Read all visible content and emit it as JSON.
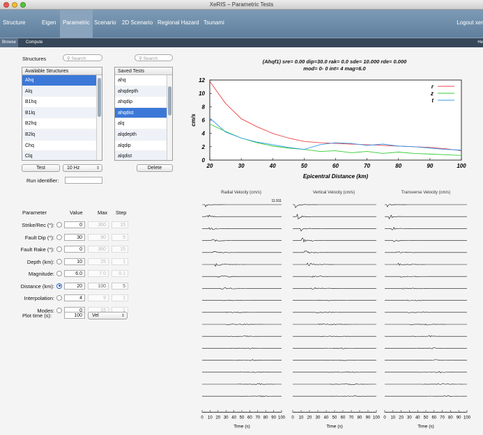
{
  "window": {
    "title": "XeRIS – Parametric Tests",
    "light_colors": [
      "#ee5a52",
      "#f5bd2f",
      "#58c43b"
    ]
  },
  "menu": {
    "items": [
      "Structure",
      "Eigen",
      "Parametric",
      "Scenario",
      "2D Scenario",
      "Regional Hazard",
      "Tsunami"
    ],
    "active": "Parametric",
    "logout": "Logout xer"
  },
  "subtabs": {
    "items": [
      "Browse",
      "Compute"
    ],
    "active": "Browse",
    "help": "He"
  },
  "structures": {
    "label": "Structures",
    "search_placeholder": "Search",
    "header": "Available Structures",
    "items": [
      "Ahq",
      "Alq",
      "B1hq",
      "B1lq",
      "B2hq",
      "B2lq",
      "Chq",
      "Clq"
    ],
    "selected": "Ahq"
  },
  "saved_tests": {
    "search_placeholder": "Search",
    "header": "Saved Tests",
    "items": [
      "ahq",
      "ahqdepth",
      "ahqdip",
      "ahqdist",
      "alq",
      "alqdepth",
      "alqdip",
      "alqdist"
    ],
    "selected": "ahqdist"
  },
  "controls": {
    "test_button": "Test",
    "frequency": "10 Hz",
    "delete_button": "Delete",
    "run_identifier_label": "Run identifier:",
    "run_identifier_value": ""
  },
  "parameters": {
    "headers": {
      "parameter": "Parameter",
      "value": "Value",
      "max": "Max",
      "step": "Step"
    },
    "rows": [
      {
        "label": "Strike/Rec (°):",
        "value": "0",
        "max": "360",
        "step": "15",
        "active": false
      },
      {
        "label": "Fault Dip (°):",
        "value": "30",
        "max": "90",
        "step": "5",
        "active": false
      },
      {
        "label": "Fault Rake (°):",
        "value": "0",
        "max": "360",
        "step": "15",
        "active": false
      },
      {
        "label": "Depth (km):",
        "value": "10",
        "max": "25",
        "step": "1",
        "active": false
      },
      {
        "label": "Magnitude:",
        "value": "6.0",
        "max": "7.0",
        "step": "0.1",
        "active": false
      },
      {
        "label": "Distance (km):",
        "value": "20",
        "max": "100",
        "step": "5",
        "active": true
      },
      {
        "label": "Interpolation:",
        "value": "4",
        "max": "9",
        "step": "1",
        "active": false
      },
      {
        "label": "Modes:",
        "value": "0",
        "max": "15",
        "step": "1",
        "active": false
      }
    ],
    "plot_time_label": "Plot time (s):",
    "plot_time_value": "100",
    "plot_mode": "Vel"
  },
  "chart_data": {
    "type": "line",
    "title_line1": "(Ahqf1) sre=  0.00 dip=30.0 rak=  0.0 sde= 10.000 rde=  0.000",
    "title_line2": "mod=  0-   0 int= 4 mag=6.0",
    "xlabel": "Epicentral Distance (km)",
    "ylabel": "cm/s",
    "xlim": [
      20,
      100
    ],
    "ylim": [
      0,
      12
    ],
    "xticks": [
      "20",
      "30",
      "40",
      "50",
      "60",
      "70",
      "80",
      "90",
      "100"
    ],
    "yticks": [
      "0",
      "2",
      "4",
      "6",
      "8",
      "10",
      "12"
    ],
    "legend_position": "top-right",
    "series": [
      {
        "name": "r",
        "color": "#ee4444",
        "x": [
          20,
          25,
          30,
          35,
          40,
          45,
          50,
          55,
          60,
          65,
          70,
          75,
          80,
          85,
          90,
          95,
          100
        ],
        "y": [
          11.8,
          8.5,
          6.2,
          5.0,
          4.0,
          3.3,
          2.8,
          2.6,
          2.5,
          2.4,
          2.3,
          2.2,
          2.1,
          2.0,
          1.9,
          1.7,
          1.4
        ]
      },
      {
        "name": "z",
        "color": "#33cc33",
        "x": [
          20,
          25,
          30,
          35,
          40,
          45,
          50,
          55,
          60,
          65,
          70,
          75,
          80,
          85,
          90,
          95,
          100
        ],
        "y": [
          5.4,
          4.3,
          3.3,
          2.6,
          2.1,
          1.8,
          1.6,
          1.3,
          1.4,
          1.1,
          1.3,
          1.0,
          1.2,
          1.0,
          0.9,
          0.8,
          0.7
        ]
      },
      {
        "name": "t",
        "color": "#3399ee",
        "x": [
          20,
          25,
          30,
          35,
          40,
          45,
          50,
          55,
          60,
          65,
          70,
          75,
          80,
          85,
          90,
          95,
          100
        ],
        "y": [
          6.3,
          4.2,
          3.3,
          2.7,
          2.3,
          1.9,
          1.6,
          2.3,
          2.6,
          2.5,
          2.2,
          2.4,
          2.1,
          2.0,
          1.8,
          1.6,
          1.5
        ]
      }
    ]
  },
  "seismograms": {
    "titles": [
      "Radial Velocity (cm/s)",
      "Vertical Velocity (cm/s)",
      "Transverse Velocity (cm/s)"
    ],
    "peak_label": "11.911",
    "trace_count": 17,
    "time_ticks": [
      "0",
      "10",
      "20",
      "30",
      "40",
      "50",
      "60",
      "70",
      "80",
      "90",
      "100"
    ],
    "xlabel": "Time (s)"
  }
}
